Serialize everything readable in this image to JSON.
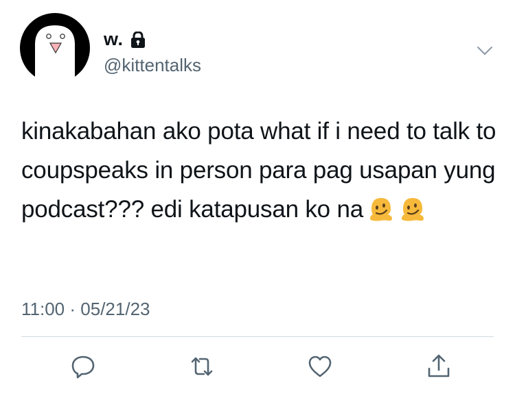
{
  "author": {
    "display_name": "w.",
    "handle": "@kittentalks",
    "protected": true
  },
  "tweet": {
    "text": "kinakabahan ako pota what if i need to talk to coupspeaks in person para pag usapan yung podcast??? edi katapusan ko na",
    "emojis": [
      "melting-face-emoji",
      "melting-face-emoji"
    ],
    "time": "11:00",
    "separator": "·",
    "date": "05/21/23"
  },
  "actions": [
    "reply-icon",
    "retweet-icon",
    "like-icon",
    "share-icon"
  ],
  "colors": {
    "text": "#0f1419",
    "secondary": "#536471",
    "divider": "#cfd9de",
    "emoji": "#f6b93b"
  }
}
